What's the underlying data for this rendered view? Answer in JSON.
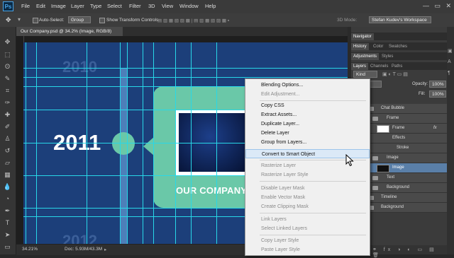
{
  "app": {
    "logo": "Ps",
    "window_controls": [
      "—",
      "▭",
      "✕"
    ]
  },
  "menu": [
    "File",
    "Edit",
    "Image",
    "Layer",
    "Type",
    "Select",
    "Filter",
    "3D",
    "View",
    "Window",
    "Help"
  ],
  "options_bar": {
    "auto_select_label": "Auto-Select:",
    "auto_select_value": "Group",
    "show_transform_label": "Show Transform Controls",
    "mode_label": "3D Mode:",
    "workspace": "Stefan Kudev's Workspace"
  },
  "document": {
    "tab_title": "Our Company.psd @ 34.2% (Image, RGB/8)",
    "zoom": "34.21%",
    "doc_size": "Doc: 5.93M/43.3M"
  },
  "canvas_text": {
    "year_top": "2010",
    "year_main": "2011",
    "year_bottom": "2012",
    "company": "OUR COMPANY"
  },
  "panels": {
    "top_tabs": [
      "Navigator"
    ],
    "second_tabs": [
      "History",
      "Color",
      "Swatches"
    ],
    "third_tabs": [
      "Adjustments",
      "Styles"
    ],
    "layer_tabs": [
      "Layers",
      "Channels",
      "Paths"
    ],
    "kind_label": "Kind",
    "opacity_label": "Opacity:",
    "opacity_value": "100%",
    "fill_label": "Fill:",
    "fill_value": "100%"
  },
  "layers": [
    {
      "name": "Chat Bubble",
      "type": "group"
    },
    {
      "name": "Frame",
      "type": "group"
    },
    {
      "name": "Frame",
      "type": "layer",
      "fx": "fx"
    },
    {
      "name": "Effects",
      "type": "effect"
    },
    {
      "name": "Stroke",
      "type": "effect"
    },
    {
      "name": "Image",
      "type": "group"
    },
    {
      "name": "Image",
      "type": "layer",
      "selected": true
    },
    {
      "name": "Text",
      "type": "group"
    },
    {
      "name": "Background",
      "type": "group"
    },
    {
      "name": "Timeline",
      "type": "group"
    },
    {
      "name": "Background",
      "type": "group"
    }
  ],
  "context_menu": [
    {
      "label": "Blending Options...",
      "disabled": false
    },
    {
      "label": "Edit Adjustment...",
      "disabled": true
    },
    {
      "label": "Copy CSS",
      "disabled": false
    },
    {
      "label": "Extract Assets...",
      "disabled": false
    },
    {
      "label": "Duplicate Layer...",
      "disabled": false
    },
    {
      "label": "Delete Layer",
      "disabled": false
    },
    {
      "label": "Group from Layers...",
      "disabled": false
    },
    {
      "label": "Convert to Smart Object",
      "disabled": false,
      "highlighted": true
    },
    {
      "label": "Rasterize Layer",
      "disabled": true
    },
    {
      "label": "Rasterize Layer Style",
      "disabled": true
    },
    {
      "label": "Disable Layer Mask",
      "disabled": true
    },
    {
      "label": "Enable Vector Mask",
      "disabled": true
    },
    {
      "label": "Create Clipping Mask",
      "disabled": true
    },
    {
      "label": "Link Layers",
      "disabled": true
    },
    {
      "label": "Select Linked Layers",
      "disabled": true
    },
    {
      "label": "Copy Layer Style",
      "disabled": true
    },
    {
      "label": "Paste Layer Style",
      "disabled": true
    }
  ],
  "colors": {
    "canvas": "#1c3f7a",
    "accent": "#6ac8a8",
    "guides": "#28d8e8",
    "highlight": "#dbe9f7"
  }
}
